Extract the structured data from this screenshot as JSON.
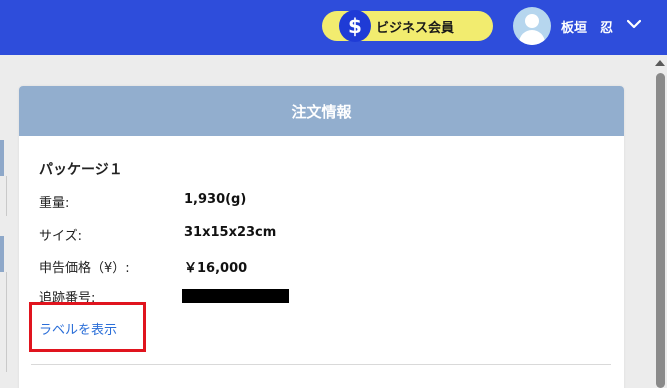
{
  "header": {
    "badge": {
      "icon": "dollar-icon",
      "icon_glyph": "$",
      "label": "ビジネス会員"
    },
    "user": {
      "avatar_icon": "user-avatar-icon",
      "name": "板垣　忍",
      "menu_icon": "chevron-down-icon"
    },
    "colors": {
      "bar": "#2e4ddb",
      "badge_bg": "#f2ec6f",
      "badge_icon_bg": "#1f3bd6"
    }
  },
  "panel": {
    "title": "注文情報",
    "header_color": "#92aece",
    "package_title": "パッケージ１",
    "rows": [
      {
        "label": "重量:",
        "value": "1,930(g)"
      },
      {
        "label": "サイズ:",
        "value": "31x15x23cm"
      },
      {
        "label": "申告価格（¥）:",
        "value": "￥16,000"
      },
      {
        "label": "追跡番号:",
        "value": ""
      }
    ],
    "label_link": "ラベルを表示",
    "highlight_color": "#e0141e"
  }
}
